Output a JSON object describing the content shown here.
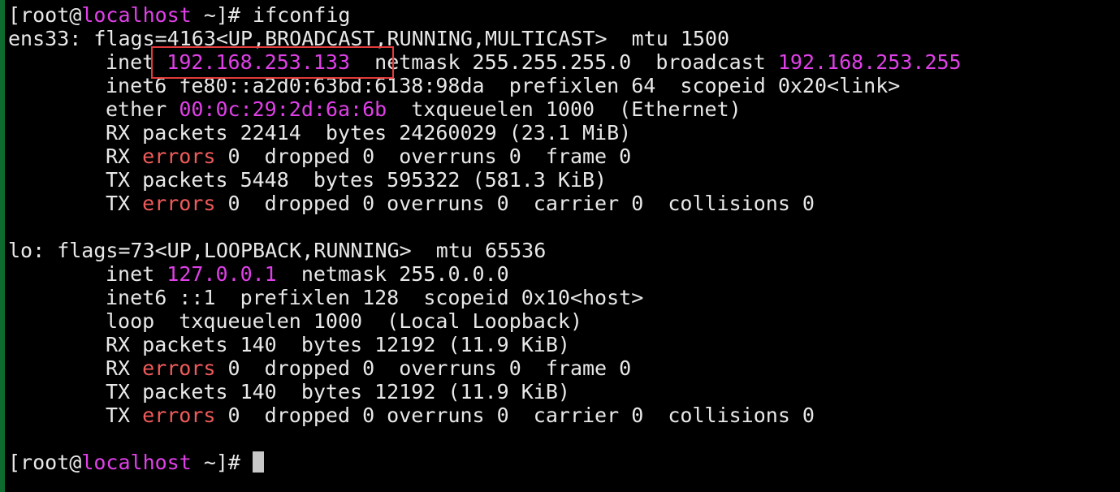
{
  "colors": {
    "background": "#000000",
    "text": "#e8e8e8",
    "highlight_magenta": "#e040e8",
    "highlight_red": "#f05a5a",
    "annotation_box": "#e43b3b",
    "left_border": "#0e6b2f"
  },
  "prompt": {
    "open": "[root@",
    "host": "localhost",
    "close": " ~]# ",
    "command": "ifconfig"
  },
  "ens33": {
    "header": "ens33: flags=4163<UP,BROADCAST,RUNNING,MULTICAST>  mtu 1500",
    "inet_label": "inet ",
    "inet_addr": "192.168.253.133",
    "netmask_text": "  netmask 255.255.255.0  broadcast ",
    "broadcast_addr": "192.168.253.255",
    "inet6": "inet6 fe80::a2d0:63bd:6138:98da  prefixlen 64  scopeid 0x20<link>",
    "ether_label": "ether ",
    "ether_mac": "00:0c:29:2d:6a:6b",
    "ether_rest": "  txqueuelen 1000  (Ethernet)",
    "rx_packets": "RX packets 22414  bytes 24260029 (23.1 MiB)",
    "rx_errors_prefix": "RX ",
    "errors_word": "errors",
    "rx_errors_rest": " 0  dropped 0  overruns 0  frame 0",
    "tx_packets": "TX packets 5448  bytes 595322 (581.3 KiB)",
    "tx_errors_prefix": "TX ",
    "tx_errors_rest": " 0  dropped 0 overruns 0  carrier 0  collisions 0"
  },
  "lo": {
    "header": "lo: flags=73<UP,LOOPBACK,RUNNING>  mtu 65536",
    "inet_label": "inet ",
    "inet_addr": "127.0.0.1",
    "netmask_text": "  netmask 255.0.0.0",
    "inet6": "inet6 ::1  prefixlen 128  scopeid 0x10<host>",
    "loop": "loop  txqueuelen 1000  (Local Loopback)",
    "rx_packets": "RX packets 140  bytes 12192 (11.9 KiB)",
    "rx_errors_prefix": "RX ",
    "errors_word": "errors",
    "rx_errors_rest": " 0  dropped 0  overruns 0  frame 0",
    "tx_packets": "TX packets 140  bytes 12192 (11.9 KiB)",
    "tx_errors_prefix": "TX ",
    "tx_errors_rest": " 0  dropped 0 overruns 0  carrier 0  collisions 0"
  },
  "final_prompt": {
    "open": "[root@",
    "host": "localhost",
    "close": " ~]#"
  }
}
